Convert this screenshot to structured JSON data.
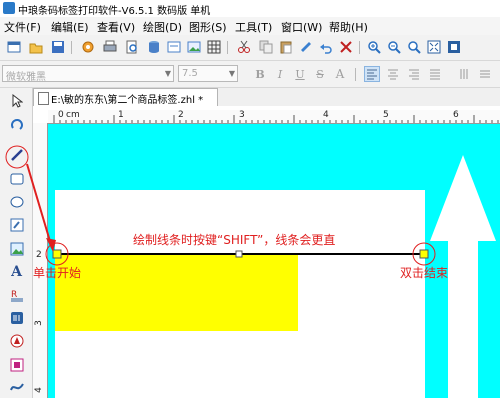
{
  "window": {
    "title": "中琅条码标签打印软件-V6.5.1 数码版 单机"
  },
  "menu": [
    {
      "label": "文件(F)"
    },
    {
      "label": "编辑(E)"
    },
    {
      "label": "查看(V)"
    },
    {
      "label": "绘图(D)"
    },
    {
      "label": "图形(S)"
    },
    {
      "label": "工具(T)"
    },
    {
      "label": "窗口(W)"
    },
    {
      "label": "帮助(H)"
    }
  ],
  "format_bar": {
    "font_name": "微软雅黑",
    "font_size": "7.5"
  },
  "document": {
    "tab_title": "E:\\敏的东东\\第二个商品标签.zhl *"
  },
  "ruler": {
    "unit": "cm",
    "top_labels": [
      "0",
      "1",
      "2",
      "3",
      "4",
      "5",
      "6"
    ],
    "left_labels": [
      "2",
      "3",
      "4"
    ]
  },
  "annotations": {
    "instruction": "绘制线条时按键“SHIFT”，线条会更直",
    "start_hint": "单击开始",
    "end_hint": "双击结束"
  },
  "colors": {
    "canvas_bg": "#00ffff",
    "label_bg": "#ffffff",
    "rect_fill": "#ffff00",
    "annotation": "#e02020",
    "active_tool_circle": "#e02020"
  },
  "icons": {
    "tool_active": "line-tool-icon",
    "arrow_shape": "up-arrow-shape"
  }
}
